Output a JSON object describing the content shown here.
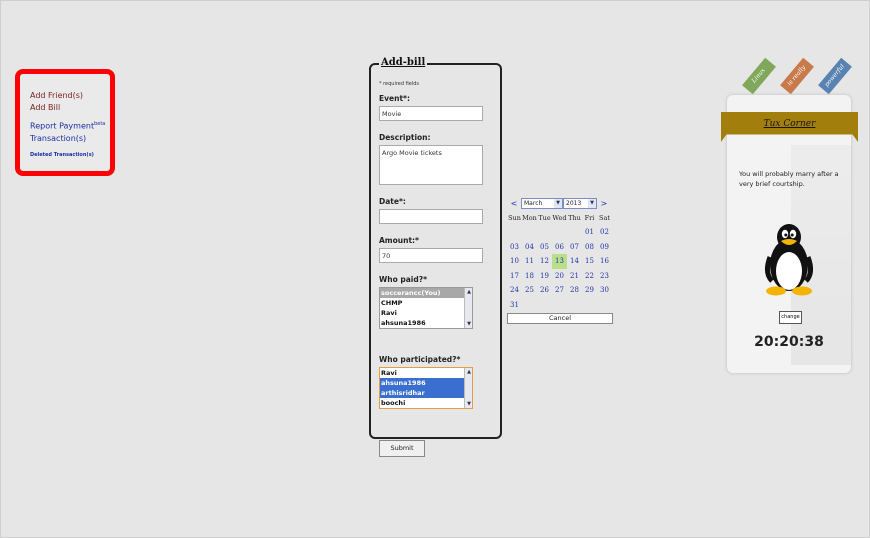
{
  "nav": {
    "add_friends": "Add Friend(s)",
    "add_bill": "Add Bill",
    "report_payment": "Report Payment",
    "report_payment_badge": "beta",
    "transactions": "Transaction(s)",
    "deleted_transactions": "Deleted Transaction(s)"
  },
  "form": {
    "legend": "Add-bill",
    "required_note": "* required fields",
    "event_label": "Event*:",
    "event_value": "Movie",
    "description_label": "Description:",
    "description_value": "Argo Movie tickets",
    "date_label": "Date*:",
    "date_value": "",
    "amount_label": "Amount:*",
    "amount_value": "70",
    "who_paid_label": "Who paid?*",
    "who_paid_options": [
      "soccerancc(You)",
      "CHMP",
      "Ravi",
      "ahsuna1986"
    ],
    "who_participated_label": "Who participated?*",
    "who_participated_options": [
      "Ravi",
      "ahsuna1986",
      "arthisridhar",
      "boochi"
    ],
    "submit_label": "Submit"
  },
  "calendar": {
    "prev": "<",
    "next": ">",
    "month": "March",
    "year": "2013",
    "day_names": [
      "Sun",
      "Mon",
      "Tue",
      "Wed",
      "Thu",
      "Fri",
      "Sat"
    ],
    "days": [
      "",
      "",
      "",
      "",
      "",
      "01",
      "02",
      "03",
      "04",
      "05",
      "06",
      "07",
      "08",
      "09",
      "10",
      "11",
      "12",
      "13",
      "14",
      "15",
      "16",
      "17",
      "18",
      "19",
      "20",
      "21",
      "22",
      "23",
      "24",
      "25",
      "26",
      "27",
      "28",
      "29",
      "30",
      "31",
      "",
      "",
      "",
      "",
      "",
      ""
    ],
    "today": "13",
    "cancel_label": "Cancel"
  },
  "widget": {
    "tabs": [
      "Linux",
      "is really",
      "powerful"
    ],
    "title": "Tux Corner",
    "fortune": "You will probably marry after a very brief courtship.",
    "change_label": "change",
    "time": "20:20:38",
    "colors": {
      "ribbon": "#a27f0c",
      "tab1": "#7fa85a",
      "tab2": "#c87a4a",
      "tab3": "#5a82b0"
    }
  }
}
